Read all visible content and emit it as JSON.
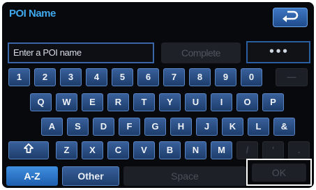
{
  "header": {
    "title": "POI Name",
    "back_icon": "back-arrow-icon"
  },
  "entry": {
    "placeholder": "Enter a POI name",
    "complete_label": "Complete",
    "more_label": "•••"
  },
  "keyboard": {
    "row_numbers": [
      "1",
      "2",
      "3",
      "4",
      "5",
      "6",
      "7",
      "8",
      "9",
      "0"
    ],
    "row_q": [
      "Q",
      "W",
      "E",
      "R",
      "T",
      "Y",
      "U",
      "I",
      "O",
      "P"
    ],
    "row_a": [
      "A",
      "S",
      "D",
      "F",
      "G",
      "H",
      "J",
      "K",
      "L",
      "&"
    ],
    "row_z": [
      "Z",
      "X",
      "C",
      "V",
      "B",
      "N",
      "M"
    ],
    "shift_icon": "shift-arrow-icon",
    "dash_label": "—",
    "slash_label": "/",
    "apostrophe_label": "'",
    "period_label": "."
  },
  "bottom": {
    "az_label": "A-Z",
    "other_label": "Other",
    "space_label": "Space",
    "ok_label": "OK"
  },
  "colors": {
    "title": "#3fa7ec",
    "key": "#2c5289",
    "background": "#08090c"
  }
}
